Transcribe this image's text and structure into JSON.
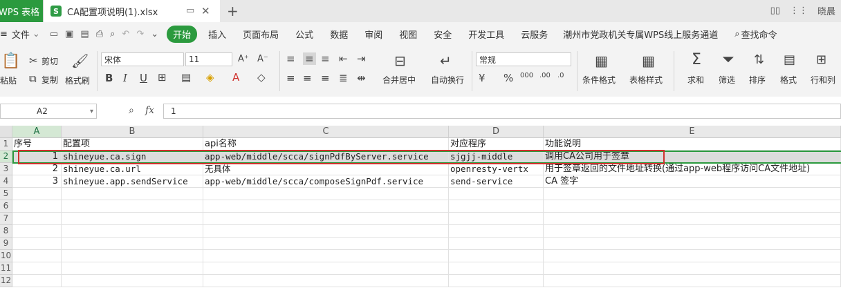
{
  "titlebar": {
    "app_tab": "WPS 表格",
    "file_tab": "CA配置项说明(1).xlsx",
    "file_icon": "S",
    "user": "晓晨"
  },
  "menu": {
    "file": "文件",
    "start": "开始",
    "items": [
      "插入",
      "页面布局",
      "公式",
      "数据",
      "审阅",
      "视图",
      "安全",
      "开发工具",
      "云服务",
      "潮州市党政机关专属WPS线上服务通道"
    ],
    "search": "查找命令"
  },
  "ribbon": {
    "paste": "粘贴",
    "cut": "剪切",
    "copy": "复制",
    "format_painter": "格式刷",
    "font_name": "宋体",
    "font_size": "11",
    "merge": "合并居中",
    "wrap": "自动换行",
    "number_format": "常规",
    "conditional_format": "条件格式",
    "table_style": "表格样式",
    "sum": "求和",
    "filter": "筛选",
    "sort": "排序",
    "format": "格式",
    "rows_cols": "行和列"
  },
  "formula_bar": {
    "name_box": "A2",
    "fx": "fx",
    "value": "1"
  },
  "sheet": {
    "columns": [
      "A",
      "B",
      "C",
      "D",
      "E"
    ],
    "rows": [
      {
        "n": "1",
        "A": "序号",
        "B": "配置项",
        "C": "api名称",
        "D": "对应程序",
        "E": "功能说明"
      },
      {
        "n": "2",
        "A": "1",
        "B": "shineyue.ca.sign",
        "C": "app-web/middle/scca/signPdfByServer.service",
        "D": "sjgjj-middle",
        "E": "调用CA公司用于签章"
      },
      {
        "n": "3",
        "A": "2",
        "B": "shineyue.ca.url",
        "C": "无具体",
        "D": "openresty-vertx",
        "E": "用于签章返回的文件地址转换(通过app-web程序访问CA文件地址)"
      },
      {
        "n": "4",
        "A": "3",
        "B": "shineyue.app.sendService",
        "C": "app-web/middle/scca/composeSignPdf.service",
        "D": "send-service",
        "E": "CA 签字"
      },
      {
        "n": "5"
      },
      {
        "n": "6"
      },
      {
        "n": "7"
      },
      {
        "n": "8"
      },
      {
        "n": "9"
      },
      {
        "n": "10"
      },
      {
        "n": "11"
      },
      {
        "n": "12"
      }
    ]
  },
  "colors": {
    "accent": "#2b9a3e",
    "highlight_box": "#d0312d"
  }
}
